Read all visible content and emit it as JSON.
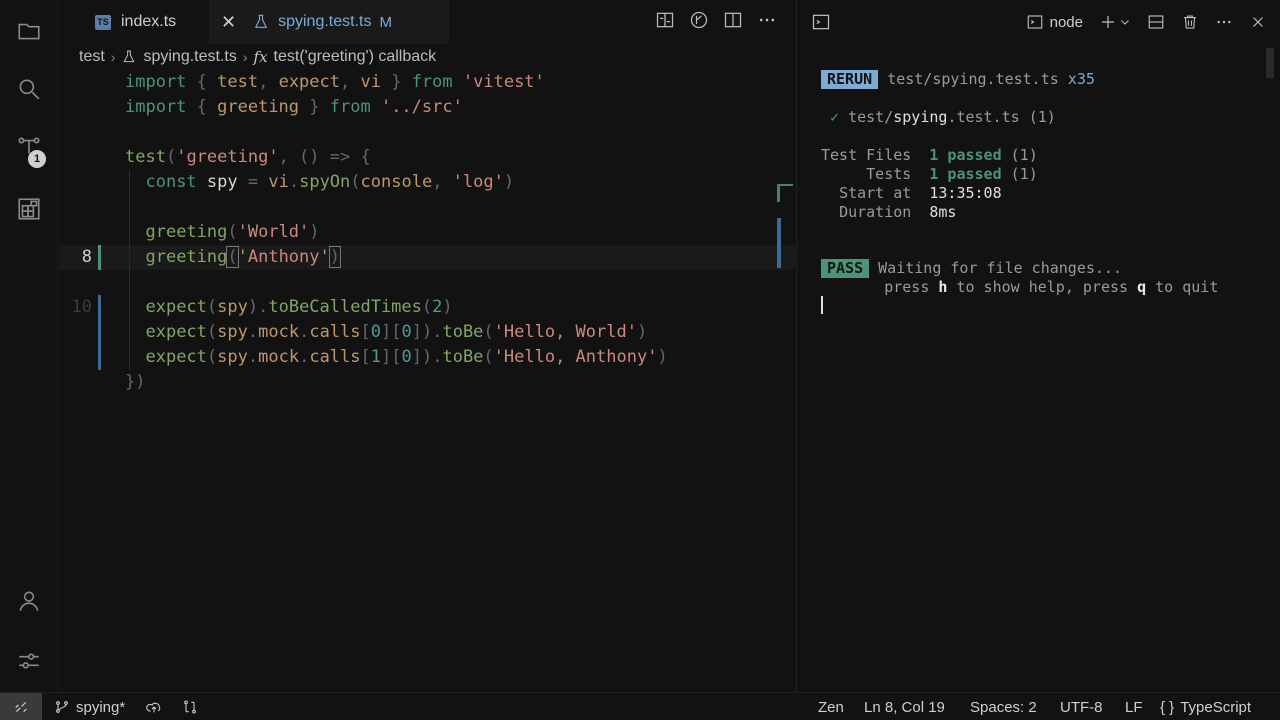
{
  "activity": {
    "items": [
      {
        "name": "explorer-icon"
      },
      {
        "name": "search-icon"
      },
      {
        "name": "source-control-icon"
      },
      {
        "name": "extensions-icon"
      }
    ],
    "scm_badge": "1",
    "bottom": [
      {
        "name": "account-icon"
      },
      {
        "name": "settings-icon"
      }
    ]
  },
  "tabs": [
    {
      "label": "index.ts",
      "icon": "TS"
    },
    {
      "label": "spying.test.ts",
      "status": "M"
    }
  ],
  "breadcrumb": [
    "test",
    "spying.test.ts",
    "test('greeting') callback"
  ],
  "code": {
    "current_line": "8",
    "line_ten": "10",
    "lines": [
      {
        "tokens": [
          [
            "kw",
            "import"
          ],
          [
            "pn",
            " { "
          ],
          [
            "id",
            "test"
          ],
          [
            "pn",
            ", "
          ],
          [
            "id",
            "expect"
          ],
          [
            "pn",
            ", "
          ],
          [
            "id",
            "vi"
          ],
          [
            "pn",
            " } "
          ],
          [
            "kw",
            "from"
          ],
          [
            "pn",
            " "
          ],
          [
            "st",
            "'vitest'"
          ]
        ]
      },
      {
        "tokens": [
          [
            "kw",
            "import"
          ],
          [
            "pn",
            " { "
          ],
          [
            "id",
            "greeting"
          ],
          [
            "pn",
            " } "
          ],
          [
            "kw",
            "from"
          ],
          [
            "pn",
            " "
          ],
          [
            "st",
            "'../src'"
          ]
        ]
      },
      {
        "tokens": []
      },
      {
        "tokens": [
          [
            "fn",
            "test"
          ],
          [
            "pn",
            "("
          ],
          [
            "st",
            "'greeting'"
          ],
          [
            "pn",
            ", () => {"
          ]
        ]
      },
      {
        "tokens": [
          [
            "pl",
            "  "
          ],
          [
            "kw",
            "const"
          ],
          [
            "pl",
            " spy "
          ],
          [
            "pn",
            "="
          ],
          [
            "pl",
            " "
          ],
          [
            "id",
            "vi"
          ],
          [
            "pn",
            "."
          ],
          [
            "fn",
            "spyOn"
          ],
          [
            "pn",
            "("
          ],
          [
            "id",
            "console"
          ],
          [
            "pn",
            ", "
          ],
          [
            "st",
            "'log'"
          ],
          [
            "pn",
            ")"
          ]
        ]
      },
      {
        "tokens": []
      },
      {
        "tokens": [
          [
            "pl",
            "  "
          ],
          [
            "fn",
            "greeting"
          ],
          [
            "pn",
            "("
          ],
          [
            "st",
            "'World'"
          ],
          [
            "pn",
            ")"
          ]
        ]
      },
      {
        "tokens": [
          [
            "pl",
            "  "
          ],
          [
            "fn",
            "greeting"
          ],
          [
            "pn",
            "("
          ],
          [
            "st",
            "'Anthony'"
          ],
          [
            "pn",
            ")"
          ]
        ]
      },
      {
        "tokens": []
      },
      {
        "tokens": [
          [
            "pl",
            "  "
          ],
          [
            "fn",
            "expect"
          ],
          [
            "pn",
            "("
          ],
          [
            "id",
            "spy"
          ],
          [
            "pn",
            ")."
          ],
          [
            "fn",
            "toBeCalledTimes"
          ],
          [
            "pn",
            "("
          ],
          [
            "nm",
            "2"
          ],
          [
            "pn",
            ")"
          ]
        ]
      },
      {
        "tokens": [
          [
            "pl",
            "  "
          ],
          [
            "fn",
            "expect"
          ],
          [
            "pn",
            "("
          ],
          [
            "id",
            "spy"
          ],
          [
            "pn",
            "."
          ],
          [
            "id",
            "mock"
          ],
          [
            "pn",
            "."
          ],
          [
            "id",
            "calls"
          ],
          [
            "pn",
            "["
          ],
          [
            "nm",
            "0"
          ],
          [
            "pn",
            "]["
          ],
          [
            "nm",
            "0"
          ],
          [
            "pn",
            "])."
          ],
          [
            "fn",
            "toBe"
          ],
          [
            "pn",
            "("
          ],
          [
            "st",
            "'Hello, World'"
          ],
          [
            "pn",
            ")"
          ]
        ]
      },
      {
        "tokens": [
          [
            "pl",
            "  "
          ],
          [
            "fn",
            "expect"
          ],
          [
            "pn",
            "("
          ],
          [
            "id",
            "spy"
          ],
          [
            "pn",
            "."
          ],
          [
            "id",
            "mock"
          ],
          [
            "pn",
            "."
          ],
          [
            "id",
            "calls"
          ],
          [
            "pn",
            "["
          ],
          [
            "nm",
            "1"
          ],
          [
            "pn",
            "]["
          ],
          [
            "nm",
            "0"
          ],
          [
            "pn",
            "])."
          ],
          [
            "fn",
            "toBe"
          ],
          [
            "pn",
            "("
          ],
          [
            "st",
            "'Hello, Anthony'"
          ],
          [
            "pn",
            ")"
          ]
        ]
      },
      {
        "tokens": [
          [
            "pn",
            "})"
          ]
        ]
      }
    ]
  },
  "terminal": {
    "profile": "node",
    "rerun_tag": "RERUN",
    "rerun_file": "test/spying.test.ts",
    "rerun_count": "x35",
    "check": "✓",
    "file_dir": "test/",
    "file_name": "spying",
    "file_ext": ".test.ts",
    "file_count": "(1)",
    "test_files_label": "Test Files",
    "test_files_value": "1 passed",
    "test_files_count": "(1)",
    "tests_label": "Tests",
    "tests_value": "1 passed",
    "tests_count": "(1)",
    "start_label": "Start at",
    "start_value": "13:35:08",
    "duration_label": "Duration",
    "duration_value": "8ms",
    "pass_tag": "PASS",
    "waiting": "Waiting for file changes...",
    "help_press1": "press",
    "help_key1": "h",
    "help_mid": "to show help, press",
    "help_key2": "q",
    "help_end": "to quit"
  },
  "status": {
    "branch": "spying*",
    "zen": "Zen",
    "position": "Ln 8, Col 19",
    "spaces": "Spaces: 2",
    "encoding": "UTF-8",
    "eol": "LF",
    "language": "TypeScript",
    "language_icon": "{ }"
  }
}
